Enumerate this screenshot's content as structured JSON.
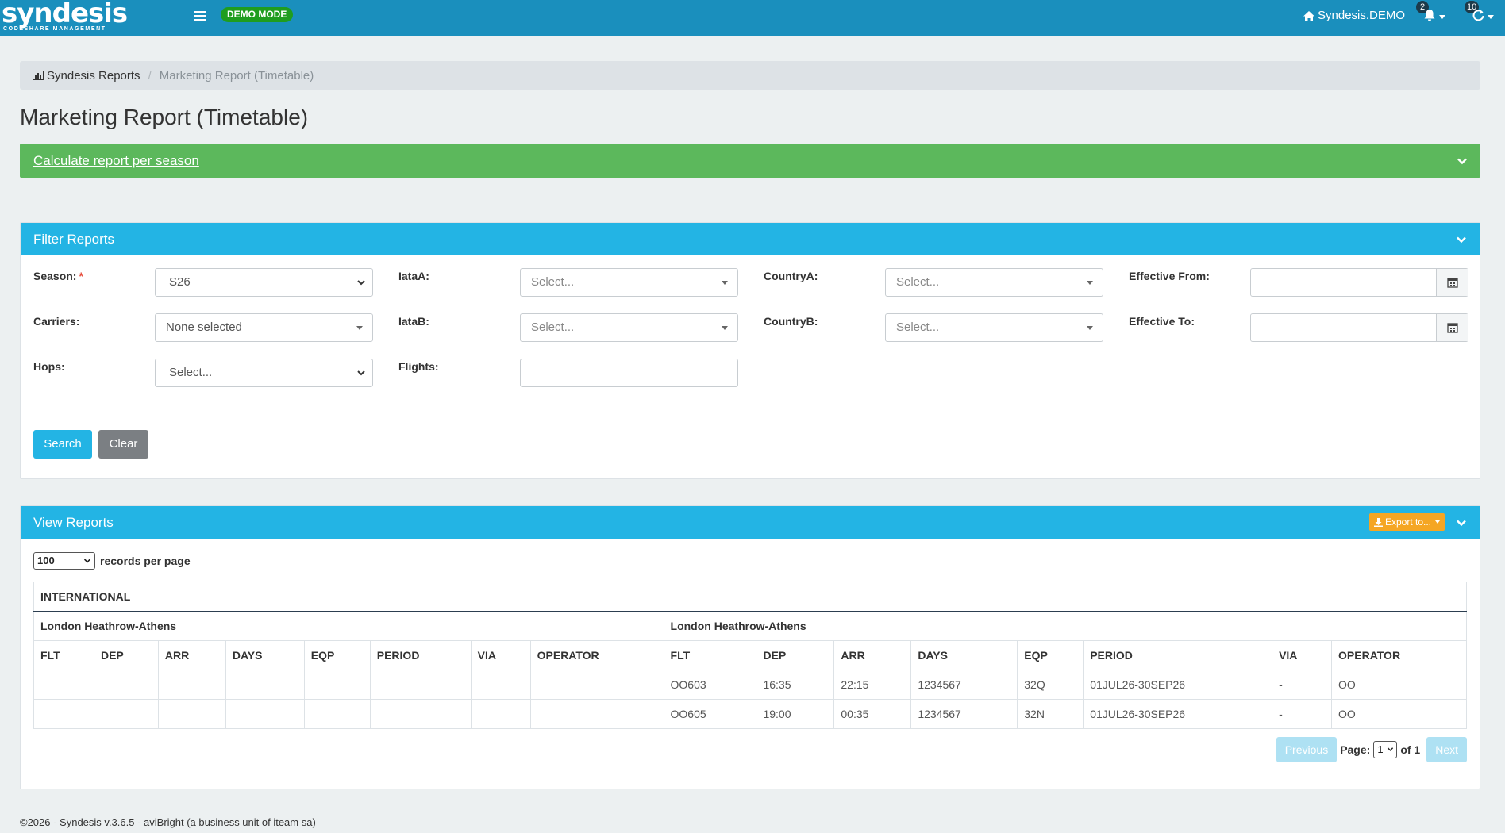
{
  "brand": {
    "name": "syndesis",
    "tagline": "CODESHARE MANAGEMENT"
  },
  "topbar": {
    "demo_badge": "DEMO MODE",
    "home_label": "Syndesis.DEMO",
    "notifications_count": "2",
    "sync_count": "10"
  },
  "breadcrumb": {
    "root": "Syndesis Reports",
    "current": "Marketing Report (Timetable)"
  },
  "page_title": "Marketing Report (Timetable)",
  "calc_panel": {
    "link_text": "Calculate report per season"
  },
  "filter": {
    "title": "Filter Reports",
    "season_label": "Season:",
    "season_required": "*",
    "season_value": "S26",
    "carriers_label": "Carriers:",
    "carriers_value": "None selected",
    "hops_label": "Hops:",
    "hops_value": "Select...",
    "iataA_label": "IataA:",
    "iataA_placeholder": "Select...",
    "iataB_label": "IataB:",
    "iataB_placeholder": "Select...",
    "flights_label": "Flights:",
    "flights_value": "",
    "countryA_label": "CountryA:",
    "countryA_placeholder": "Select...",
    "countryB_label": "CountryB:",
    "countryB_placeholder": "Select...",
    "eff_from_label": "Effective From:",
    "eff_to_label": "Effective To:",
    "search_label": "Search",
    "clear_label": "Clear"
  },
  "view": {
    "title": "View Reports",
    "export_label": "Export to...",
    "records_per_page": "100",
    "records_per_page_label": "records per page",
    "section": "INTERNATIONAL",
    "left_route": "London Heathrow-Athens",
    "right_route": "London Heathrow-Athens",
    "columns": [
      "FLT",
      "DEP",
      "ARR",
      "DAYS",
      "EQP",
      "PERIOD",
      "VIA",
      "OPERATOR"
    ],
    "rows": [
      {
        "flt": "OO603",
        "dep": "16:35",
        "arr": "22:15",
        "days": "1234567",
        "eqp": "32Q",
        "period": "01JUL26-30SEP26",
        "via": "-",
        "operator": "OO"
      },
      {
        "flt": "OO605",
        "dep": "19:00",
        "arr": "00:35",
        "days": "1234567",
        "eqp": "32N",
        "period": "01JUL26-30SEP26",
        "via": "-",
        "operator": "OO"
      }
    ],
    "pager": {
      "previous": "Previous",
      "page_label": "Page:",
      "page_value": "1",
      "of_label": "of 1",
      "next": "Next"
    }
  },
  "footer": "©2026 - Syndesis v.3.6.5 - aviBright (a business unit of iteam sa)",
  "colors": {
    "topbar": "#1a8fbd",
    "panel_head": "#23b4e4",
    "success": "#5cb85c",
    "export": "#f5a623",
    "demo": "#1f9d1f"
  }
}
